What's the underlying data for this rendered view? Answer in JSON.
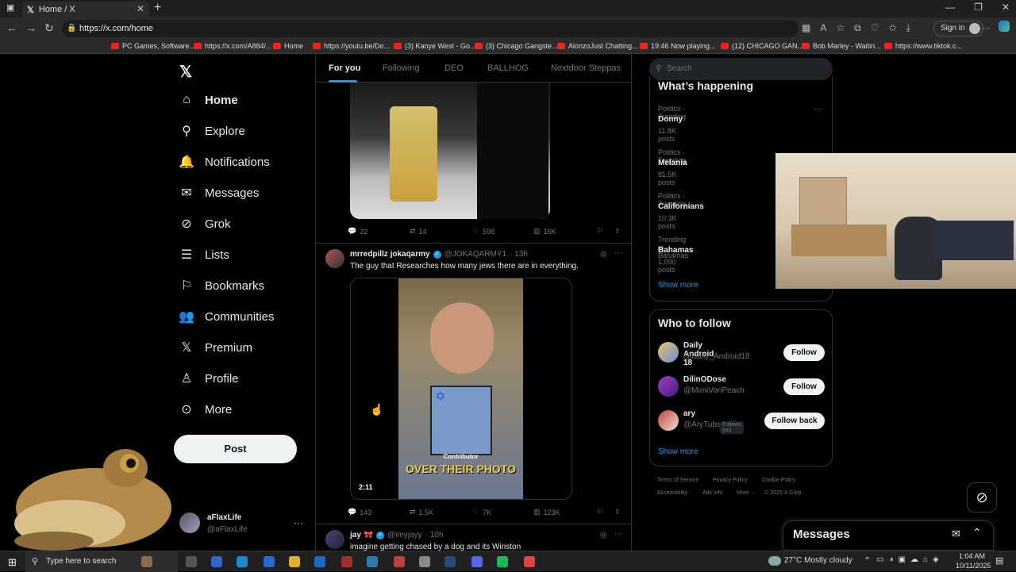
{
  "browser": {
    "tab_title": "Home / X",
    "url": "https://x.com/home",
    "sign_in": "Sign in",
    "bookmarks": [
      "PC Games, Software...",
      "https://x.com/A884/...",
      "Home",
      "https://youtu.be/Do...",
      "(3) Kanye West - Go...",
      "(3) Chicago Gangste...",
      "AlonzoJust Chatting...",
      "19:46 Now playing...",
      "(12) CHICAGO GAN...",
      "Bob Marley - Waitin...",
      "https://www.tiktok.c..."
    ]
  },
  "sidebar": {
    "items": [
      {
        "label": "Home",
        "icon": "home-icon"
      },
      {
        "label": "Explore",
        "icon": "search-icon"
      },
      {
        "label": "Notifications",
        "icon": "bell-icon"
      },
      {
        "label": "Messages",
        "icon": "envelope-icon"
      },
      {
        "label": "Grok",
        "icon": "grok-icon"
      },
      {
        "label": "Lists",
        "icon": "list-icon"
      },
      {
        "label": "Bookmarks",
        "icon": "bookmark-icon"
      },
      {
        "label": "Communities",
        "icon": "people-icon"
      },
      {
        "label": "Premium",
        "icon": "x-logo-icon"
      },
      {
        "label": "Profile",
        "icon": "person-icon"
      },
      {
        "label": "More",
        "icon": "more-circle-icon"
      }
    ],
    "post_label": "Post",
    "account": {
      "name": "aFlaxLife",
      "handle": "@aFlaxLife"
    }
  },
  "feed": {
    "tabs": [
      "For you",
      "Following",
      "DEO",
      "BALLHOG",
      "Nextdoor Steppas"
    ],
    "tweet1_stats": {
      "replies": "22",
      "retweets": "14",
      "likes": "598",
      "views": "16K"
    },
    "tweet2": {
      "name": "mrredpillz jokaqarmy",
      "handle": "@JOKAQARMY1",
      "time": "· 13h",
      "text": "The guy that Researches how many jews there are in everything.",
      "video_time": "2:11",
      "overlay_label": "Contributor",
      "overlay_caption": "OVER THEIR PHOTO",
      "stats": {
        "replies": "143",
        "retweets": "1.5K",
        "likes": "7K",
        "views": "123K"
      }
    },
    "tweet3": {
      "name": "jay",
      "handle": "@imyjayy",
      "time": "· 10h",
      "text": "imagine getting chased by a dog and its Winston"
    }
  },
  "right": {
    "search_placeholder": "Search",
    "happening_title": "What’s happening",
    "trends": [
      {
        "meta": "Politics · Trending",
        "name": "Donny",
        "posts": "11.8K posts"
      },
      {
        "meta": "Politics · Trending",
        "name": "Melania",
        "posts": "81.5K posts"
      },
      {
        "meta": "Politics · Trending",
        "name": "Californians",
        "posts": "10.3K posts"
      },
      {
        "meta": "Trending in Bahamas",
        "name": "Bahamas",
        "posts": "1,090 posts"
      }
    ],
    "show_more": "Show more",
    "wtf_title": "Who to follow",
    "wtf": [
      {
        "name": "Daily Android 18",
        "handle": "@Daily_Android18",
        "button": "Follow",
        "badge": ""
      },
      {
        "name": "DilinODose",
        "handle": "@MimiVonPeach",
        "button": "Follow",
        "badge": ""
      },
      {
        "name": "ary",
        "handle": "@AryTubs",
        "button": "Follow back",
        "badge": "Follows you"
      }
    ],
    "footer": [
      "Terms of Service",
      "Privacy Policy",
      "Cookie Policy",
      "Accessibility",
      "Ads info",
      "More ···",
      "© 2025 X Corp."
    ],
    "messages_title": "Messages"
  },
  "taskbar": {
    "search_placeholder": "Type here to search",
    "weather": "27°C  Mostly cloudy",
    "time": "1:04 AM",
    "date": "10/11/2025"
  },
  "colors": {
    "accent": "#1d9bf0",
    "bg": "#000000",
    "muted": "#71767b"
  }
}
